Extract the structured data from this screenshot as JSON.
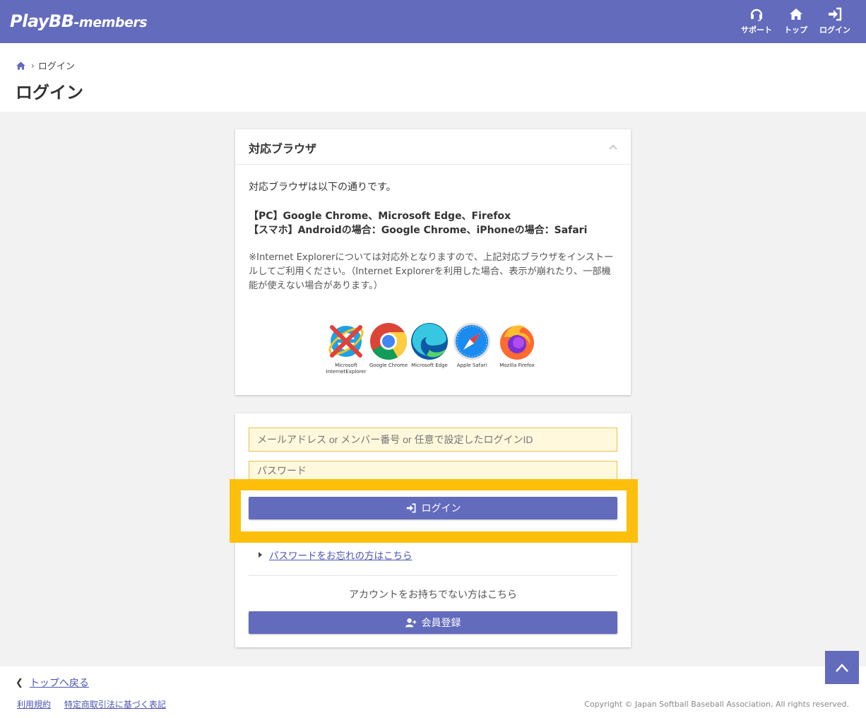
{
  "header": {
    "logo_main": "PlayBB",
    "logo_sub": "-members",
    "nav": [
      {
        "label": "サポート",
        "icon": "headset-icon"
      },
      {
        "label": "トップ",
        "icon": "home-icon"
      },
      {
        "label": "ログイン",
        "icon": "sign-in-icon"
      }
    ]
  },
  "breadcrumb": {
    "home_icon": "home-icon",
    "current": "ログイン"
  },
  "page_title": "ログイン",
  "browser_panel": {
    "title": "対応ブラウザ",
    "intro": "対応ブラウザは以下の通りです。",
    "pc_line": "【PC】Google Chrome、Microsoft Edge、Firefox",
    "sp_line": "【スマホ】Androidの場合：Google Chrome、iPhoneの場合：Safari",
    "note": "※Internet Explorerについては対応外となりますので、上記対応ブラウザをインストールしてご利用ください。（Internet Explorerを利用した場合、表示が崩れたり、一部機能が使えない場合があります。）",
    "browsers": [
      {
        "caption": "Microsoft InternetExplorer",
        "icon": "internet-explorer-icon"
      },
      {
        "caption": "Google Chrome",
        "icon": "chrome-icon"
      },
      {
        "caption": "Microsoft Edge",
        "icon": "edge-icon"
      },
      {
        "caption": "Apple Safari",
        "icon": "safari-icon"
      },
      {
        "caption": "Mozilla Firefox",
        "icon": "firefox-icon"
      }
    ]
  },
  "login_form": {
    "id_placeholder": "メールアドレス or メンバー番号 or 任意で設定したログインID",
    "password_placeholder": "パスワード",
    "login_button": "ログイン",
    "forgot_link": "パスワードをお忘れの方はこちら",
    "no_account_text": "アカウントをお持ちでない方はこちら",
    "register_button": "会員登録"
  },
  "footer": {
    "back_link": "トップへ戻る",
    "links": [
      "利用規約",
      "特定商取引法に基づく表記"
    ],
    "copyright": "Copyright © Japan Softball Baseball Association, All rights reserved."
  },
  "colors": {
    "primary": "#636bbd",
    "highlight": "#fdbf0b",
    "field_bg": "#fff8dc"
  }
}
